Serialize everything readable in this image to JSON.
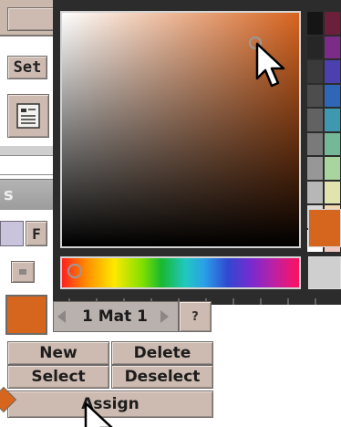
{
  "left_panel": {
    "set_label": "Set",
    "f_label": "F",
    "rollout_fragment": "s",
    "material_color": "#d6651e"
  },
  "color_picker": {
    "base_hue_color": "#d7641f",
    "current_color": "#d6651e",
    "original_color": "#cfcfcf",
    "palette": [
      "#151515",
      "#6b1f3a",
      "#262626",
      "#7a2c86",
      "#3a3a3a",
      "#4c3fb0",
      "#4d4d4d",
      "#2f66b8",
      "#626262",
      "#3d98b0",
      "#7a7a7a",
      "#74b898",
      "#979797",
      "#a8d49e",
      "#b7b7b7",
      "#e2e4ae",
      "#d8d8d8",
      "#f2d6b0",
      "#ffffff",
      "#ecc8c0"
    ]
  },
  "material_bar": {
    "name": "1 Mat 1",
    "help_label": "?"
  },
  "actions": {
    "new": "New",
    "delete": "Delete",
    "select": "Select",
    "deselect": "Deselect",
    "assign": "Assign"
  },
  "icons": {
    "cursor_top": "arrow-cursor-icon",
    "cursor_bottom": "arrow-cursor-icon",
    "document": "document-icon"
  }
}
